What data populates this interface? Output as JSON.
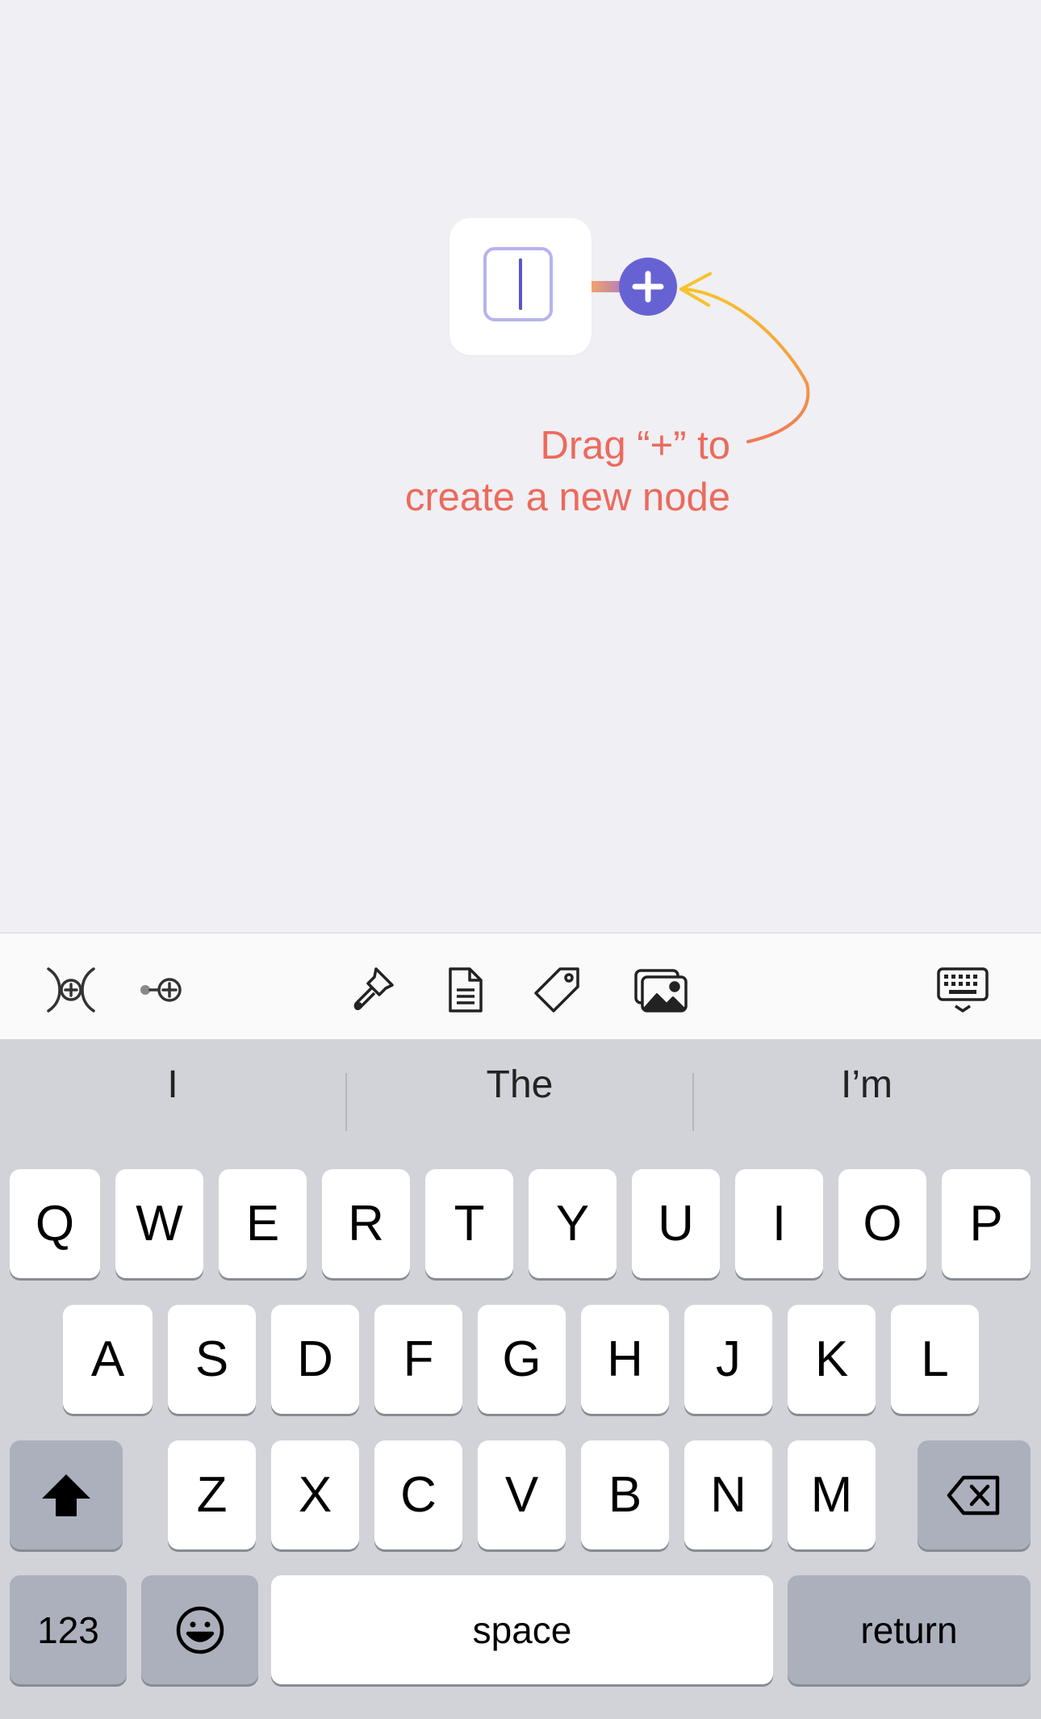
{
  "canvas": {
    "background": "#efeff4",
    "accent_color": "#6762d3",
    "hint_color": "#ec6a5c",
    "arrow_color": "#f7b32b",
    "hint_line1": "Drag “+” to",
    "hint_line2": "create a new node"
  },
  "toolbar": {
    "icons": [
      "insert-child-node-icon",
      "insert-sibling-node-icon",
      "style-brush-icon",
      "note-document-icon",
      "tag-icon",
      "image-gallery-icon",
      "dismiss-keyboard-icon"
    ]
  },
  "keyboard": {
    "suggestions": [
      "I",
      "The",
      "I’m"
    ],
    "row1": [
      "Q",
      "W",
      "E",
      "R",
      "T",
      "Y",
      "U",
      "I",
      "O",
      "P"
    ],
    "row2": [
      "A",
      "S",
      "D",
      "F",
      "G",
      "H",
      "J",
      "K",
      "L"
    ],
    "row3": [
      "Z",
      "X",
      "C",
      "V",
      "B",
      "N",
      "M"
    ],
    "numbers_label": "123",
    "space_label": "space",
    "return_label": "return"
  }
}
